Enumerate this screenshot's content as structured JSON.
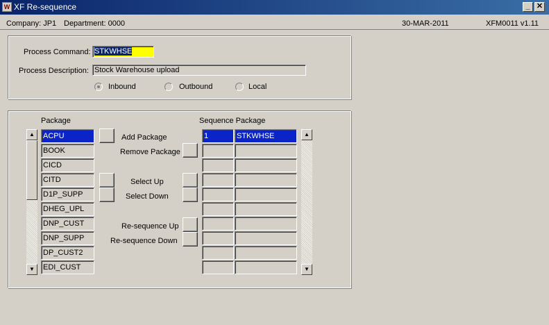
{
  "window": {
    "title": "XF Re-sequence",
    "icon_label": "W"
  },
  "info": {
    "company": "Company: JP1",
    "department": "Department: 0000",
    "date": "30-MAR-2011",
    "version": "XFM0011  v1.11"
  },
  "process": {
    "command_label": "Process Command:",
    "command_value": "STKWHSE",
    "description_label": "Process Description:",
    "description_value": "Stock Warehouse upload",
    "radios": [
      {
        "label": "Inbound",
        "selected": true
      },
      {
        "label": "Outbound",
        "selected": false
      },
      {
        "label": "Local",
        "selected": false
      }
    ]
  },
  "packages": {
    "header": "Package",
    "items": [
      "ACPU",
      "BOOK",
      "CICD",
      "CITD",
      "D1P_SUPP",
      "DHEG_UPL",
      "DNP_CUST",
      "DNP_SUPP",
      "DP_CUST2",
      "EDI_CUST"
    ]
  },
  "actions": {
    "add_package": "Add Package",
    "remove_package": "Remove Package",
    "select_up": "Select Up",
    "select_down": "Select Down",
    "resequence_up": "Re-sequence Up",
    "resequence_down": "Re-sequence Down"
  },
  "sequence": {
    "header": "Sequence Package",
    "rows": [
      {
        "seq": "1",
        "package": "STKWHSE"
      },
      {
        "seq": "",
        "package": ""
      },
      {
        "seq": "",
        "package": ""
      },
      {
        "seq": "",
        "package": ""
      },
      {
        "seq": "",
        "package": ""
      },
      {
        "seq": "",
        "package": ""
      },
      {
        "seq": "",
        "package": ""
      },
      {
        "seq": "",
        "package": ""
      },
      {
        "seq": "",
        "package": ""
      },
      {
        "seq": "",
        "package": ""
      }
    ]
  },
  "icons": {
    "scroll_up": "up-arrow-icon",
    "scroll_down": "down-arrow-icon",
    "minimize": "minimize-icon",
    "close": "close-icon"
  }
}
